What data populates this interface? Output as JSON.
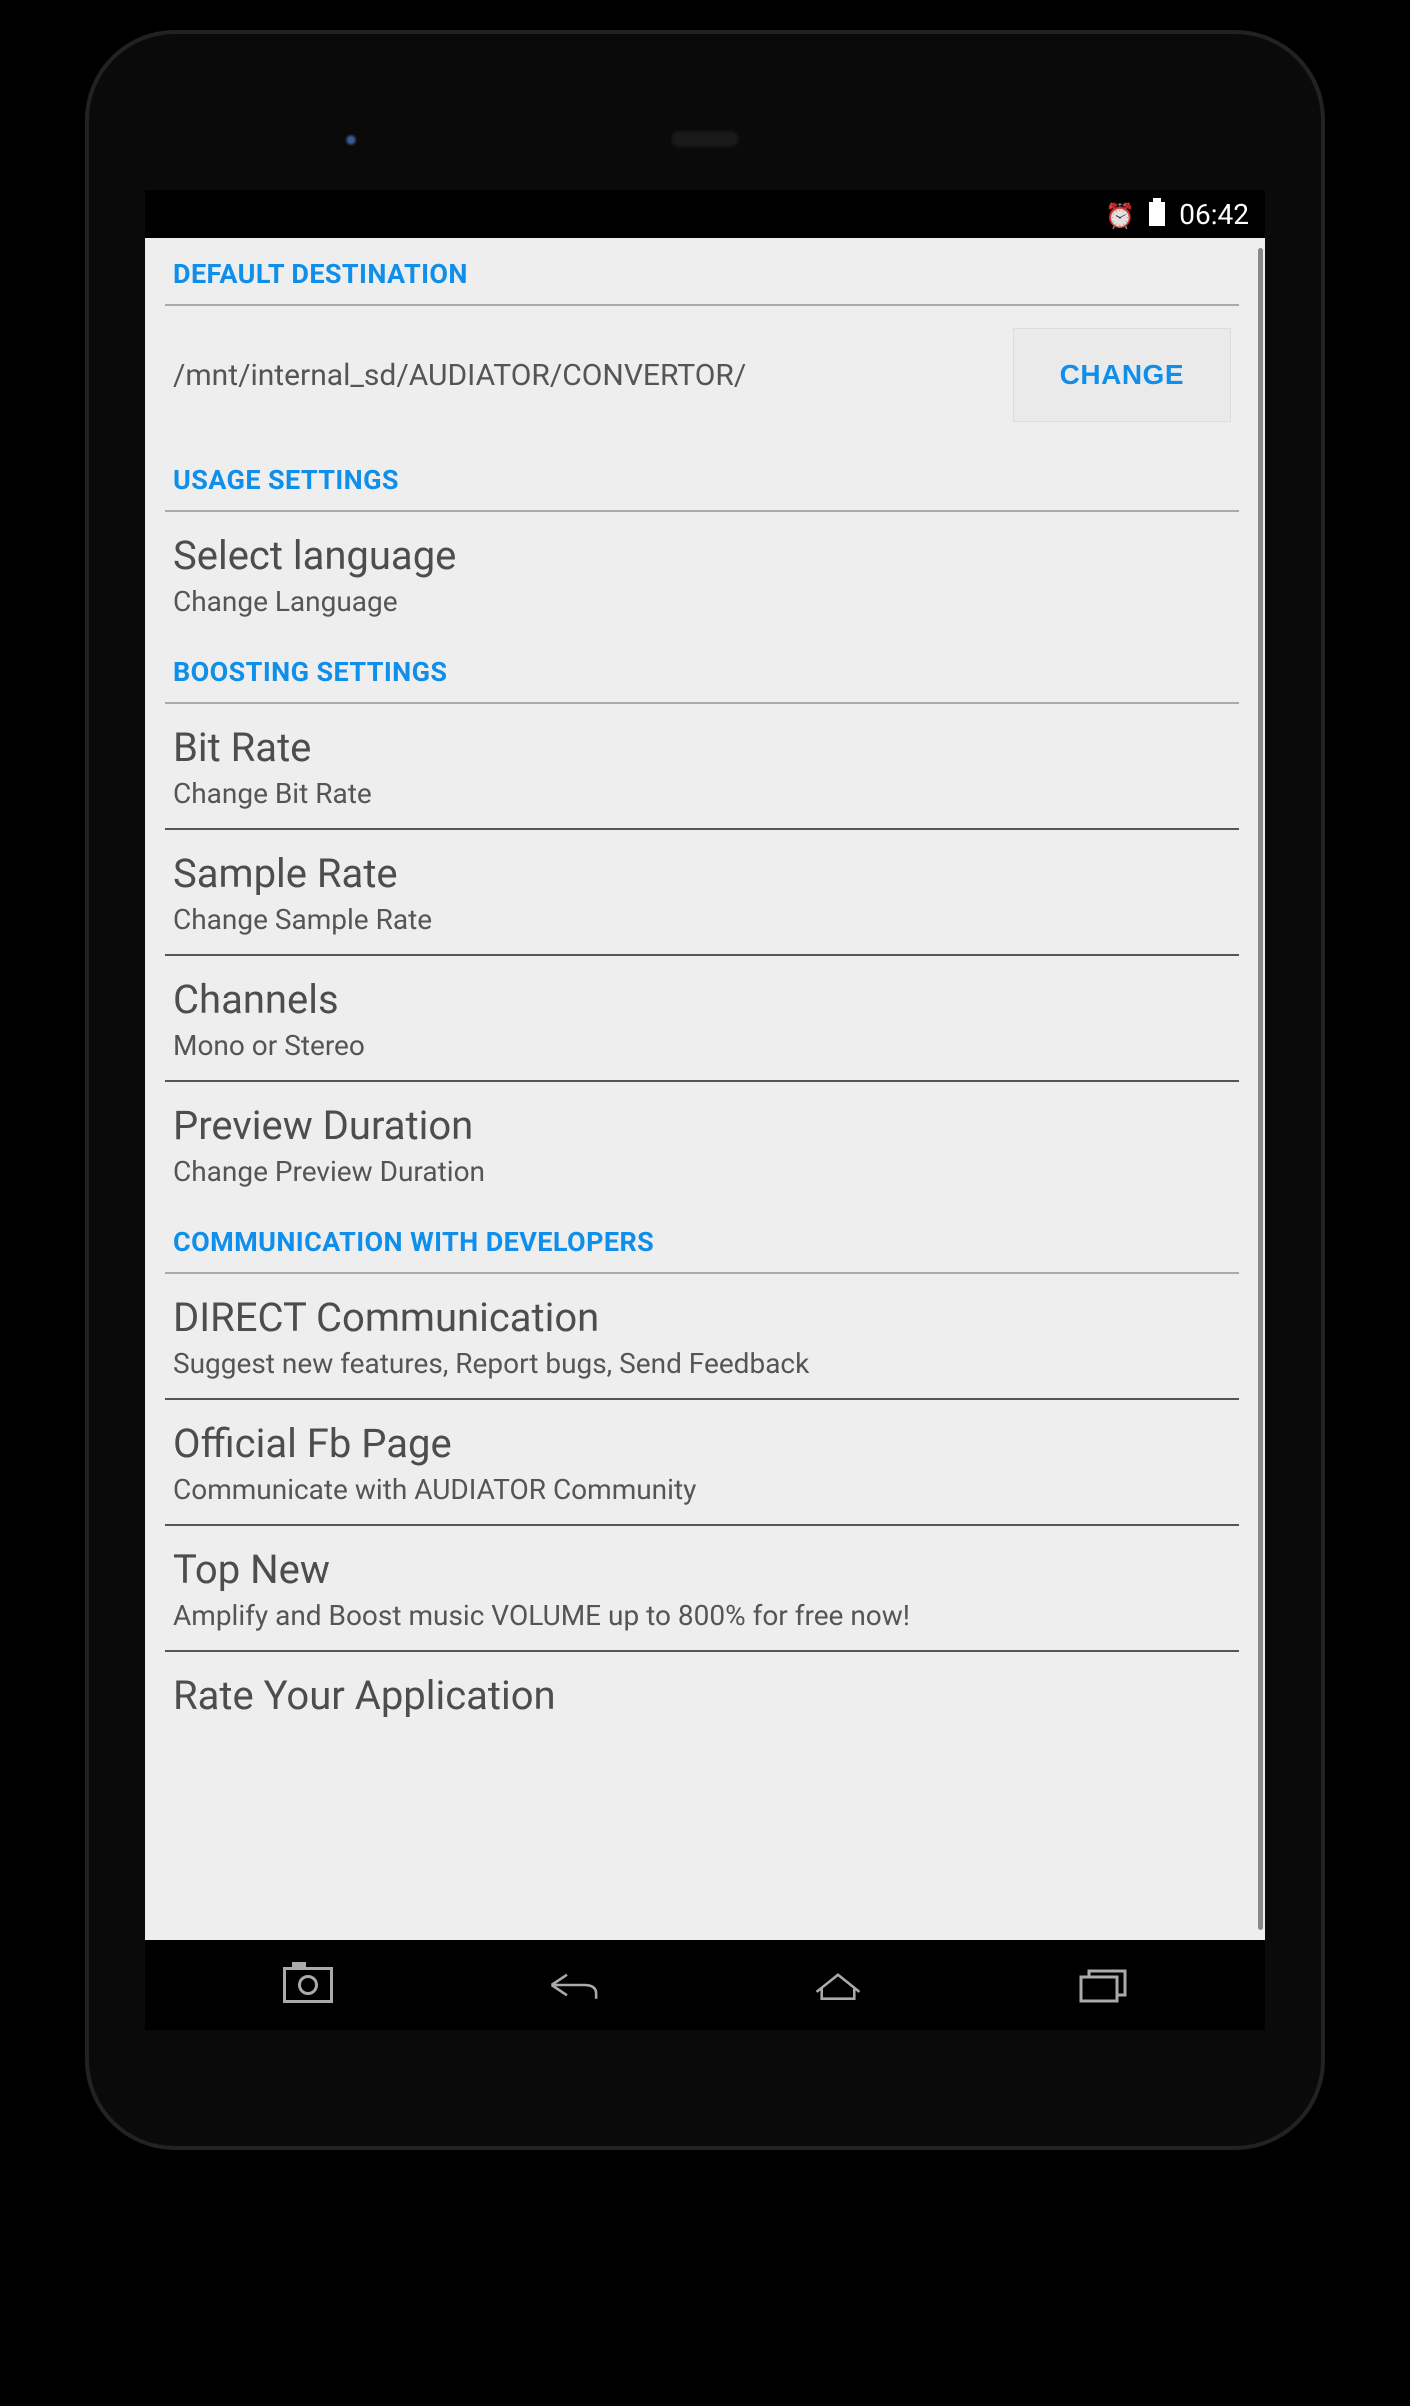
{
  "status": {
    "time": "06:42"
  },
  "sections": {
    "destination": {
      "header": "DEFAULT DESTINATION",
      "path": "/mnt/internal_sd/AUDIATOR/CONVERTOR/",
      "change_label": "CHANGE"
    },
    "usage": {
      "header": "USAGE SETTINGS",
      "language": {
        "title": "Select language",
        "sub": "Change Language"
      }
    },
    "boosting": {
      "header": "BOOSTING SETTINGS",
      "bitrate": {
        "title": "Bit Rate",
        "sub": "Change Bit Rate"
      },
      "samplerate": {
        "title": "Sample Rate",
        "sub": "Change Sample Rate"
      },
      "channels": {
        "title": "Channels",
        "sub": "Mono or Stereo"
      },
      "preview": {
        "title": "Preview Duration",
        "sub": "Change Preview Duration"
      }
    },
    "communication": {
      "header": "COMMUNICATION WITH DEVELOPERS",
      "direct": {
        "title": "DIRECT Communication",
        "sub": "Suggest new features, Report bugs, Send Feedback"
      },
      "fb": {
        "title": "Official Fb Page",
        "sub": "Communicate with AUDIATOR Community"
      },
      "topnew": {
        "title": "Top New",
        "sub": "Amplify and Boost music VOLUME up to 800% for free now!"
      },
      "rate": {
        "title": "Rate Your Application"
      }
    }
  }
}
